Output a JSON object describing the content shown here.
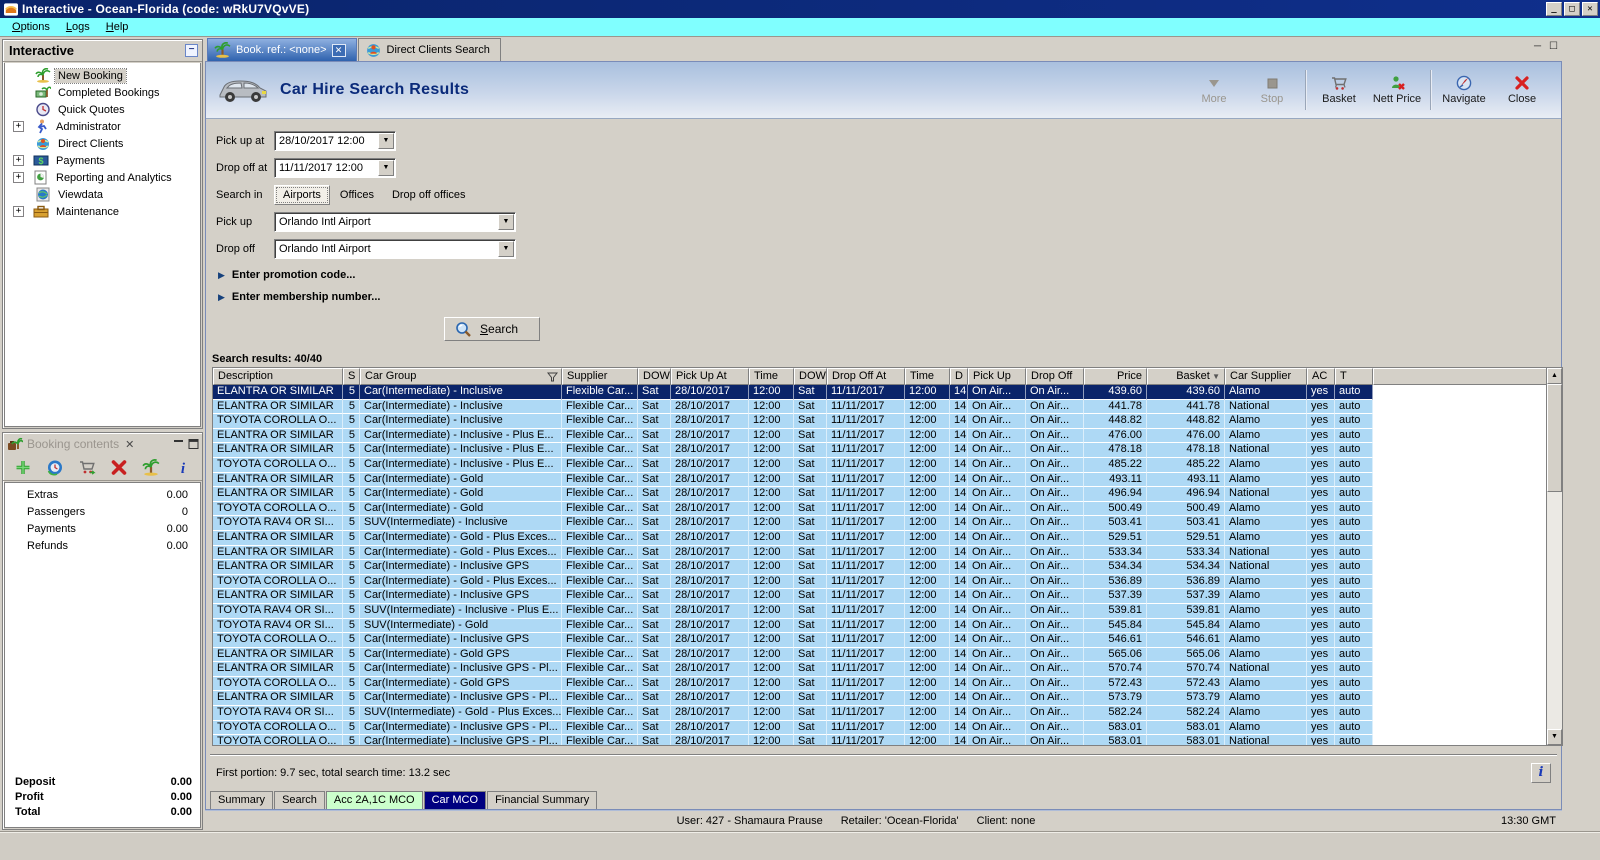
{
  "window": {
    "title": "Interactive - Ocean-Florida (code: wRkU7VQvVE)"
  },
  "menu": [
    {
      "label": "Options"
    },
    {
      "label": "Logs"
    },
    {
      "label": "Help"
    }
  ],
  "sidebar": {
    "title": "Interactive",
    "items": [
      {
        "label": "New Booking",
        "icon": "palm-tree-icon",
        "expandable": false,
        "selected": true
      },
      {
        "label": "Completed Bookings",
        "icon": "money-palm-icon",
        "expandable": false,
        "selected": false
      },
      {
        "label": "Quick Quotes",
        "icon": "clock-icon",
        "expandable": false,
        "selected": false
      },
      {
        "label": "Administrator",
        "icon": "runner-icon",
        "expandable": true,
        "selected": false
      },
      {
        "label": "Direct Clients",
        "icon": "globe-person-icon",
        "expandable": false,
        "selected": false
      },
      {
        "label": "Payments",
        "icon": "cash-icon",
        "expandable": true,
        "selected": false
      },
      {
        "label": "Reporting and Analytics",
        "icon": "report-icon",
        "expandable": true,
        "selected": false
      },
      {
        "label": "Viewdata",
        "icon": "globe-icon",
        "expandable": false,
        "selected": false
      },
      {
        "label": "Maintenance",
        "icon": "toolbox-icon",
        "expandable": true,
        "selected": false
      }
    ]
  },
  "booking_contents": {
    "title": "Booking contents",
    "close_label": "✕",
    "toolbar_icons": [
      {
        "name": "add-icon"
      },
      {
        "name": "availability-clock-icon"
      },
      {
        "name": "cart-icon"
      },
      {
        "name": "delete-cross-icon"
      },
      {
        "name": "palm-tree-icon"
      },
      {
        "name": "info-icon"
      }
    ],
    "rows": [
      {
        "label": "Extras",
        "value": "0.00"
      },
      {
        "label": "Passengers",
        "value": "0"
      },
      {
        "label": "Payments",
        "value": "0.00"
      },
      {
        "label": "Refunds",
        "value": "0.00"
      }
    ],
    "totals": [
      {
        "label": "Deposit",
        "value": "0.00"
      },
      {
        "label": "Profit",
        "value": "0.00"
      },
      {
        "label": "Total",
        "value": "0.00"
      }
    ]
  },
  "doc_tabs": [
    {
      "label": "Book. ref.: <none>",
      "icon": "palm-tree-icon",
      "active": true,
      "closable": true
    },
    {
      "label": "Direct Clients Search",
      "icon": "globe-person-icon",
      "active": false,
      "closable": false
    }
  ],
  "content": {
    "title": "Car Hire Search Results",
    "toolbar": [
      {
        "label": "More",
        "icon": "more-icon",
        "disabled": true,
        "sep_after": false
      },
      {
        "label": "Stop",
        "icon": "stop-icon",
        "disabled": true,
        "sep_after": true
      },
      {
        "label": "Basket",
        "icon": "basket-icon",
        "disabled": false,
        "sep_after": false
      },
      {
        "label": "Nett Price",
        "icon": "nett-price-icon",
        "disabled": false,
        "sep_after": true
      },
      {
        "label": "Navigate",
        "icon": "navigate-icon",
        "disabled": false,
        "sep_after": false
      },
      {
        "label": "Close",
        "icon": "close-icon",
        "disabled": false,
        "sep_after": false
      }
    ],
    "form": {
      "pickup_at_label": "Pick up at",
      "pickup_at_value": "28/10/2017 12:00",
      "dropoff_at_label": "Drop off at",
      "dropoff_at_value": "11/11/2017 12:00",
      "search_in_label": "Search in",
      "search_in_options": [
        "Airports",
        "Offices",
        "Drop off offices"
      ],
      "search_in_selected": "Airports",
      "pickup_label": "Pick up",
      "pickup_value": "Orlando Intl Airport",
      "dropoff_label": "Drop off",
      "dropoff_value": "Orlando Intl Airport",
      "promo_expander": "Enter promotion code...",
      "membership_expander": "Enter membership number...",
      "search_button": "Search"
    },
    "results_label": "Search results: 40/40",
    "table": {
      "columns": [
        {
          "label": "Description",
          "key": "description"
        },
        {
          "label": "S",
          "key": "s",
          "align": "right"
        },
        {
          "label": "Car Group",
          "key": "car_group",
          "filter_icon": true
        },
        {
          "label": "Supplier",
          "key": "supplier"
        },
        {
          "label": "DOW",
          "key": "dow1"
        },
        {
          "label": "Pick Up At",
          "key": "pick_up_at"
        },
        {
          "label": "Time",
          "key": "time1"
        },
        {
          "label": "DOW",
          "key": "dow2"
        },
        {
          "label": "Drop Off At",
          "key": "drop_off_at"
        },
        {
          "label": "Time",
          "key": "time2"
        },
        {
          "label": "D",
          "key": "d",
          "align": "right"
        },
        {
          "label": "Pick Up",
          "key": "pick_up"
        },
        {
          "label": "Drop Off",
          "key": "drop_off"
        },
        {
          "label": "Price",
          "key": "price",
          "align": "right"
        },
        {
          "label": "Basket",
          "key": "basket",
          "align": "right",
          "sort_icon": true
        },
        {
          "label": "Car Supplier",
          "key": "car_supplier"
        },
        {
          "label": "AC",
          "key": "ac"
        },
        {
          "label": "T",
          "key": "t"
        }
      ],
      "row_defaults": {
        "s": "5",
        "supplier": "Flexible Car...",
        "dow1": "Sat",
        "pick_up_at": "28/10/2017",
        "time1": "12:00",
        "dow2": "Sat",
        "drop_off_at": "11/11/2017",
        "time2": "12:00",
        "d": "14",
        "pick_up": "On Air...",
        "drop_off": "On Air...",
        "ac": "yes",
        "t": "auto"
      },
      "rows": [
        {
          "description": "ELANTRA OR SIMILAR",
          "car_group": "Car(Intermediate) - Inclusive",
          "price": "439.60",
          "basket": "439.60",
          "car_supplier": "Alamo",
          "selected": true
        },
        {
          "description": "ELANTRA OR SIMILAR",
          "car_group": "Car(Intermediate) - Inclusive",
          "price": "441.78",
          "basket": "441.78",
          "car_supplier": "National"
        },
        {
          "description": "TOYOTA COROLLA O...",
          "car_group": "Car(Intermediate) - Inclusive",
          "price": "448.82",
          "basket": "448.82",
          "car_supplier": "Alamo"
        },
        {
          "description": "ELANTRA OR SIMILAR",
          "car_group": "Car(Intermediate) - Inclusive - Plus E...",
          "price": "476.00",
          "basket": "476.00",
          "car_supplier": "Alamo"
        },
        {
          "description": "ELANTRA OR SIMILAR",
          "car_group": "Car(Intermediate) - Inclusive - Plus E...",
          "price": "478.18",
          "basket": "478.18",
          "car_supplier": "National"
        },
        {
          "description": "TOYOTA COROLLA O...",
          "car_group": "Car(Intermediate) - Inclusive - Plus E...",
          "price": "485.22",
          "basket": "485.22",
          "car_supplier": "Alamo"
        },
        {
          "description": "ELANTRA OR SIMILAR",
          "car_group": "Car(Intermediate) - Gold",
          "price": "493.11",
          "basket": "493.11",
          "car_supplier": "Alamo"
        },
        {
          "description": "ELANTRA OR SIMILAR",
          "car_group": "Car(Intermediate) - Gold",
          "price": "496.94",
          "basket": "496.94",
          "car_supplier": "National"
        },
        {
          "description": "TOYOTA COROLLA O...",
          "car_group": "Car(Intermediate) - Gold",
          "price": "500.49",
          "basket": "500.49",
          "car_supplier": "Alamo"
        },
        {
          "description": "TOYOTA RAV4 OR SI...",
          "car_group": "SUV(Intermediate) - Inclusive",
          "price": "503.41",
          "basket": "503.41",
          "car_supplier": "Alamo"
        },
        {
          "description": "ELANTRA OR SIMILAR",
          "car_group": "Car(Intermediate) - Gold - Plus Exces...",
          "price": "529.51",
          "basket": "529.51",
          "car_supplier": "Alamo"
        },
        {
          "description": "ELANTRA OR SIMILAR",
          "car_group": "Car(Intermediate) - Gold - Plus Exces...",
          "price": "533.34",
          "basket": "533.34",
          "car_supplier": "National"
        },
        {
          "description": "ELANTRA OR SIMILAR",
          "car_group": "Car(Intermediate) - Inclusive GPS",
          "price": "534.34",
          "basket": "534.34",
          "car_supplier": "National"
        },
        {
          "description": "TOYOTA COROLLA O...",
          "car_group": "Car(Intermediate) - Gold - Plus Exces...",
          "price": "536.89",
          "basket": "536.89",
          "car_supplier": "Alamo"
        },
        {
          "description": "ELANTRA OR SIMILAR",
          "car_group": "Car(Intermediate) - Inclusive GPS",
          "price": "537.39",
          "basket": "537.39",
          "car_supplier": "Alamo"
        },
        {
          "description": "TOYOTA RAV4 OR SI...",
          "car_group": "SUV(Intermediate) - Inclusive - Plus E...",
          "price": "539.81",
          "basket": "539.81",
          "car_supplier": "Alamo"
        },
        {
          "description": "TOYOTA RAV4 OR SI...",
          "car_group": "SUV(Intermediate) - Gold",
          "price": "545.84",
          "basket": "545.84",
          "car_supplier": "Alamo"
        },
        {
          "description": "TOYOTA COROLLA O...",
          "car_group": "Car(Intermediate) - Inclusive GPS",
          "price": "546.61",
          "basket": "546.61",
          "car_supplier": "Alamo"
        },
        {
          "description": "ELANTRA OR SIMILAR",
          "car_group": "Car(Intermediate) - Gold GPS",
          "price": "565.06",
          "basket": "565.06",
          "car_supplier": "Alamo"
        },
        {
          "description": "ELANTRA OR SIMILAR",
          "car_group": "Car(Intermediate) - Inclusive GPS - Pl...",
          "price": "570.74",
          "basket": "570.74",
          "car_supplier": "National"
        },
        {
          "description": "TOYOTA COROLLA O...",
          "car_group": "Car(Intermediate) - Gold GPS",
          "price": "572.43",
          "basket": "572.43",
          "car_supplier": "Alamo"
        },
        {
          "description": "ELANTRA OR SIMILAR",
          "car_group": "Car(Intermediate) - Inclusive GPS - Pl...",
          "price": "573.79",
          "basket": "573.79",
          "car_supplier": "Alamo"
        },
        {
          "description": "TOYOTA RAV4 OR SI...",
          "car_group": "SUV(Intermediate) - Gold - Plus Exces...",
          "price": "582.24",
          "basket": "582.24",
          "car_supplier": "Alamo"
        },
        {
          "description": "TOYOTA COROLLA O...",
          "car_group": "Car(Intermediate) - Inclusive GPS - Pl...",
          "price": "583.01",
          "basket": "583.01",
          "car_supplier": "Alamo"
        },
        {
          "description": "TOYOTA COROLLA O...",
          "car_group": "Car(Intermediate) - Inclusive GPS - Pl...",
          "price": "583.01",
          "basket": "583.01",
          "car_supplier": "National",
          "partial": true
        }
      ]
    },
    "status_line": "First portion: 9.7 sec, total search time: 13.2 sec",
    "bottom_tabs": [
      {
        "label": "Summary",
        "highlight": "none"
      },
      {
        "label": "Search",
        "highlight": "none"
      },
      {
        "label": "Acc 2A,1C MCO",
        "highlight": "green"
      },
      {
        "label": "Car MCO",
        "highlight": "navy"
      },
      {
        "label": "Financial Summary",
        "highlight": "none"
      }
    ]
  },
  "statusbar": {
    "user": "User: 427 - Shamaura Prause",
    "retailer": "Retailer: 'Ocean-Florida'",
    "client": "Client: none",
    "time": "13:30 GMT"
  },
  "colors": {
    "titlebar": "#0a246a",
    "menubar": "#80ffff",
    "row_blue": "#aed9f5",
    "selected_row": "#0a246a",
    "tab_green": "#ccffcc",
    "tab_navy": "#000080"
  }
}
